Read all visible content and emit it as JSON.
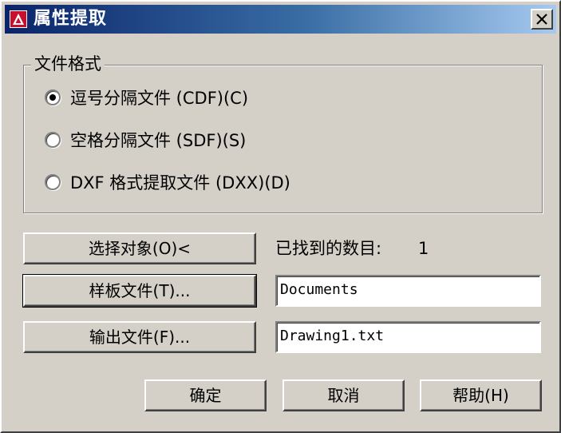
{
  "window": {
    "title": "属性提取",
    "close_label": "×"
  },
  "file_format": {
    "legend": "文件格式",
    "options": [
      {
        "label": "逗号分隔文件 (CDF)(C)",
        "checked": true
      },
      {
        "label": "空格分隔文件 (SDF)(S)",
        "checked": false
      },
      {
        "label": "DXF 格式提取文件 (DXX)(D)",
        "checked": false
      }
    ]
  },
  "actions": {
    "select_objects_label": "选择对象(O)<",
    "found_count_label": "已找到的数目:",
    "found_count_value": "1",
    "template_file_label": "样板文件(T)...",
    "template_file_value": "Documents",
    "output_file_label": "输出文件(F)...",
    "output_file_value": "Drawing1.txt"
  },
  "footer": {
    "ok_label": "确定",
    "cancel_label": "取消",
    "help_label": "帮助(H)"
  },
  "colors": {
    "face": "#d4d0c8",
    "title_start": "#0a246a",
    "title_end": "#a6caf0",
    "icon_red": "#c8102e"
  }
}
